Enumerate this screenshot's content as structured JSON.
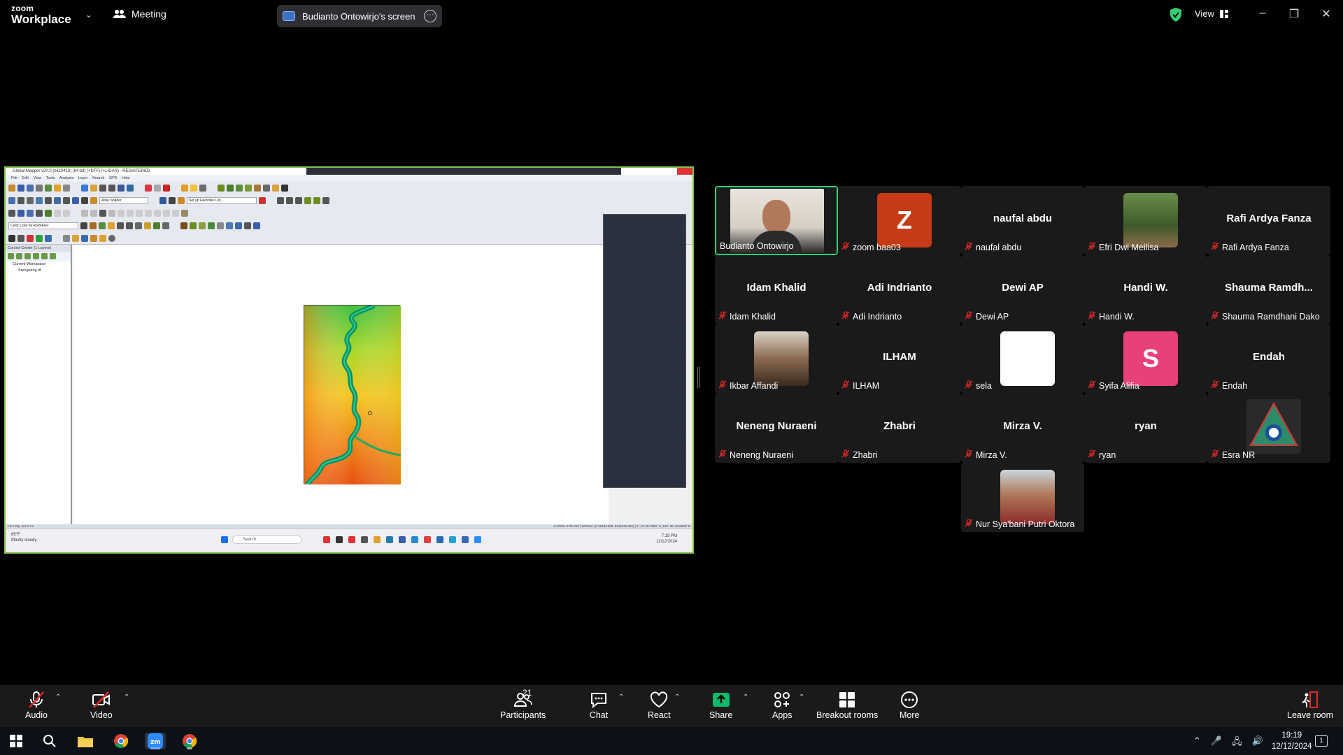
{
  "titlebar": {
    "brand_top": "zoom",
    "brand_bottom": "Workplace",
    "meeting_label": "Meeting",
    "share_label": "Budianto Ontowirjo's screen",
    "view_label": "View"
  },
  "shared_screen": {
    "window_title": "Global Mapper v20.0 (b110418) [64-bit] (+DTF) (+LIDAR) - REGISTERED",
    "menu": "File Edit View Tools Analysis Layer Search GPS Help",
    "shader_select": "Atlas Shader",
    "favorites_select": "Set up Favorites List...",
    "lidar_select": "Color Lidar by RGB/Elev",
    "control_center_title": "Control Center (1 Layers)",
    "layer_root": "Current Workspace",
    "layer_item": "Srengseng.tif",
    "status_left": "For Help, press F1",
    "status_right": "1:43766 UTM 48S | WGS84 | (715433.209, 9311015.343) | 6° 13' 49.7953\" S, 106° 56' 49.5539\" E",
    "weather_temp": "85°F",
    "weather_desc": "Mostly cloudy",
    "search_placeholder": "Search",
    "clock_time": "7:19 PM",
    "clock_date": "12/12/2024"
  },
  "participants": [
    {
      "name": "Budianto Ontowirjo",
      "display": "",
      "kind": "video",
      "muted": false,
      "active": true
    },
    {
      "name": "zoom baa03",
      "display": "Z",
      "kind": "letter",
      "color": "#c63b15",
      "muted": true
    },
    {
      "name": "naufal abdu",
      "display": "naufal abdu",
      "kind": "name",
      "muted": true
    },
    {
      "name": "Efri Dwi Meilisa",
      "display": "",
      "kind": "photo",
      "muted": true
    },
    {
      "name": "Rafi Ardya Fanza",
      "display": "Rafi Ardya Fanza",
      "kind": "name",
      "muted": true
    },
    {
      "name": "Idam Khalid",
      "display": "Idam Khalid",
      "kind": "name",
      "muted": true
    },
    {
      "name": "Adi Indrianto",
      "display": "Adi Indrianto",
      "kind": "name",
      "muted": true
    },
    {
      "name": "Dewi AP",
      "display": "Dewi AP",
      "kind": "name",
      "muted": true
    },
    {
      "name": "Handi W.",
      "display": "Handi W.",
      "kind": "name",
      "muted": true
    },
    {
      "name": "Shauma Ramdhani Dako",
      "display": "Shauma  Ramdh...",
      "kind": "name",
      "muted": true
    },
    {
      "name": "Ikbar Affandi",
      "display": "",
      "kind": "photo",
      "muted": true
    },
    {
      "name": "ILHAM",
      "display": "ILHAM",
      "kind": "name",
      "muted": true
    },
    {
      "name": "sela",
      "display": "",
      "kind": "blank",
      "muted": true
    },
    {
      "name": "Syifa Alifia",
      "display": "S",
      "kind": "letter",
      "color": "#e8407a",
      "muted": true
    },
    {
      "name": "Endah",
      "display": "Endah",
      "kind": "name",
      "muted": true
    },
    {
      "name": "Neneng Nuraeni",
      "display": "Neneng Nuraeni",
      "kind": "name",
      "muted": true
    },
    {
      "name": "Zhabri",
      "display": "Zhabri",
      "kind": "name",
      "muted": true
    },
    {
      "name": "Mirza V.",
      "display": "Mirza V.",
      "kind": "name",
      "muted": true
    },
    {
      "name": "ryan",
      "display": "ryan",
      "kind": "name",
      "muted": true
    },
    {
      "name": "Esra NR",
      "display": "",
      "kind": "logo",
      "muted": true
    },
    {
      "name": "Nur Sya'bani Putri Oktora",
      "display": "",
      "kind": "photo",
      "muted": true
    }
  ],
  "toolbar": {
    "audio": "Audio",
    "video": "Video",
    "participants": "Participants",
    "participants_count": "21",
    "chat": "Chat",
    "react": "React",
    "share": "Share",
    "apps": "Apps",
    "breakout": "Breakout rooms",
    "more": "More",
    "leave": "Leave room"
  },
  "taskbar": {
    "time": "19:19",
    "date": "12/12/2024",
    "notifications": "1"
  },
  "colors": {
    "active_speaker": "#2fcf73",
    "share_green": "#12b76a",
    "muted_red": "#e02828"
  }
}
